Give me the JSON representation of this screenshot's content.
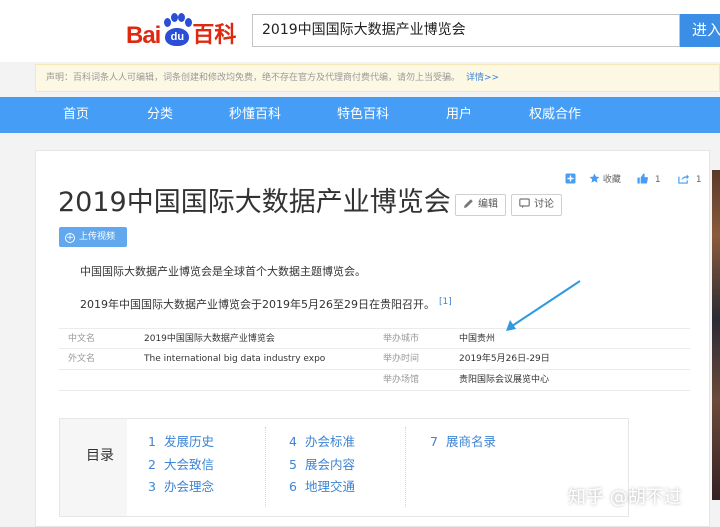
{
  "logo": {
    "part1": "Bai",
    "paw": "du",
    "part2": "百科"
  },
  "search": {
    "value": "2019中国国际大数据产业博览会",
    "button": "进入"
  },
  "notice": {
    "text": "声明：百科词条人人可编辑，词条创建和修改均免费，绝不存在官方及代理商付费代编，请勿上当受骗。",
    "link": "详情>>"
  },
  "nav": [
    "首页",
    "分类",
    "秒懂百科",
    "特色百科",
    "用户",
    "权威合作"
  ],
  "toolbar": {
    "add_icon": "plus-square-icon",
    "favorite": "收藏",
    "like_count": "1",
    "share_count": "1"
  },
  "entry": {
    "title": "2019中国国际大数据产业博览会",
    "edit": "编辑",
    "discuss": "讨论",
    "upload_video": "上传视频",
    "para1": "中国国际大数据产业博览会是全球首个大数据主题博览会。",
    "para2": "2019年中国国际大数据产业博览会于2019年5月26至29日在贵阳召开。",
    "ref": "[1]"
  },
  "infobox": {
    "left": [
      {
        "key": "中文名",
        "value": "2019中国国际大数据产业博览会"
      },
      {
        "key": "外文名",
        "value": "The international big data industry expo"
      }
    ],
    "right": [
      {
        "key": "举办城市",
        "value": "中国贵州"
      },
      {
        "key": "举办时间",
        "value": "2019年5月26日-29日"
      },
      {
        "key": "举办场馆",
        "value": "贵阳国际会议展览中心"
      }
    ]
  },
  "toc": {
    "title": "目录",
    "items": [
      {
        "num": "1",
        "label": "发展历史"
      },
      {
        "num": "2",
        "label": "大会致信"
      },
      {
        "num": "3",
        "label": "办会理念"
      },
      {
        "num": "4",
        "label": "办会标准"
      },
      {
        "num": "5",
        "label": "展会内容"
      },
      {
        "num": "6",
        "label": "地理交通"
      },
      {
        "num": "7",
        "label": "展商名录"
      }
    ]
  },
  "watermark": "知乎 @胡不过",
  "colors": {
    "nav": "#459df5",
    "link": "#3d85d5",
    "logo_red": "#de2910",
    "logo_blue": "#2a4fd6",
    "annotation_arrow": "#2f9ae0"
  }
}
